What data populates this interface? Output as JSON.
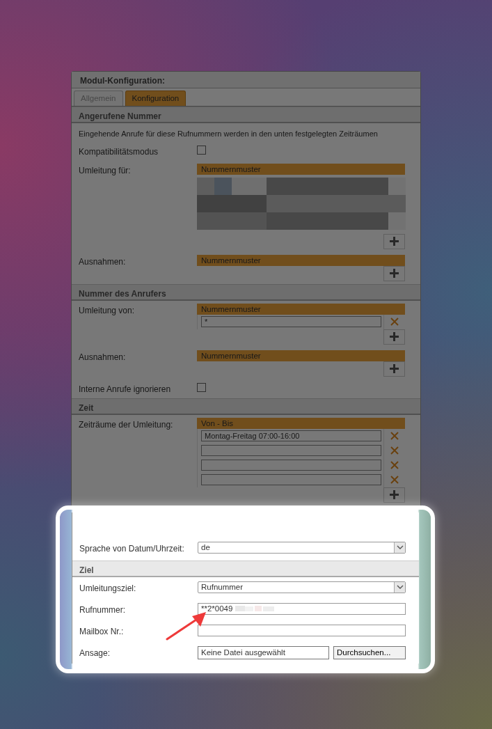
{
  "window": {
    "title": "Modul-Konfiguration:"
  },
  "tabs": [
    {
      "label": "Allgemein",
      "selected": false
    },
    {
      "label": "Konfiguration",
      "selected": true
    }
  ],
  "sections": [
    {
      "title": "Angerufene Nummer",
      "rows": [
        {
          "kind": "text",
          "text": "Eingehende Anrufe für diese Rufnummern werden in den unten festgelegten Zeiträumen"
        },
        {
          "kind": "checkbox",
          "label": "Kompatibilitätsmodus",
          "checked": false
        },
        {
          "kind": "redacted-list",
          "label": "Umleitung für:",
          "header": "Nummernmuster"
        },
        {
          "kind": "list",
          "label": "Ausnahmen:",
          "header": "Nummernmuster",
          "items": []
        }
      ]
    },
    {
      "title": "Nummer des Anrufers",
      "rows": [
        {
          "kind": "list",
          "label": "Umleitung von:",
          "header": "Nummernmuster",
          "items": [
            {
              "kind": "filled",
              "value": "*"
            }
          ]
        },
        {
          "kind": "list",
          "label": "Ausnahmen:",
          "header": "Nummernmuster",
          "items": []
        },
        {
          "kind": "checkbox",
          "label": "Interne Anrufe ignorieren",
          "checked": false
        }
      ]
    },
    {
      "title": "Zeit",
      "rows": [
        {
          "kind": "list",
          "label": "Zeiträume der Umleitung:",
          "header": "Von - Bis",
          "items": [
            {
              "kind": "filled",
              "value": "Montag-Freitag 07:00-16:00"
            },
            {
              "kind": "empty"
            },
            {
              "kind": "empty"
            },
            {
              "kind": "empty"
            }
          ]
        }
      ]
    }
  ],
  "spotlight": {
    "sections": [
      {
        "rows": [
          {
            "kind": "select",
            "label": "Sprache von Datum/Uhrzeit:",
            "value": "de"
          }
        ]
      },
      {
        "title": "Ziel",
        "rows": [
          {
            "kind": "select",
            "label": "Umleitungsziel:",
            "value": "Rufnummer"
          },
          {
            "kind": "input",
            "label": "Rufnummer:",
            "value": "**2*0049",
            "redacted": true
          },
          {
            "kind": "input",
            "label": "Mailbox Nr.:"
          },
          {
            "kind": "file",
            "label": "Ansage:",
            "value": "Keine Datei ausgewählt",
            "button": "Durchsuchen..."
          }
        ]
      }
    ]
  }
}
